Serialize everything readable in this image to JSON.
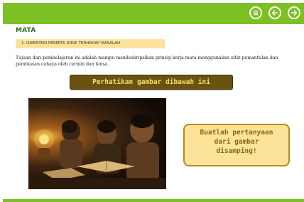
{
  "header": {
    "accent_color": "#7dc023",
    "nav": [
      {
        "name": "menu-icon"
      },
      {
        "name": "back-arrow-icon"
      },
      {
        "name": "forward-arrow-icon"
      }
    ]
  },
  "subject": "MATA",
  "section_label": "1. ORIENTASI PESERTA DIDIK TERHADAP MASALAH",
  "objective_text": "Tujuan dari pembelajaran ini adalah mampu mendeskripsikan prinsip kerja mata menggunakan sifat pemantulan dan pembiasan cahaya oleh cermin dan lensa.",
  "notice_banner": "Perhatikan gambar dibawah ini",
  "image": {
    "icon": "photo-of-children-reading-by-lamplight"
  },
  "prompt_box": {
    "lines": [
      "Buatlah pertanyaan",
      "dari gambar",
      "disamping!"
    ]
  },
  "colors": {
    "banner_bg": "#6a5210",
    "banner_text": "#f7df6a",
    "highlight_bg": "#fde39a",
    "subject_color": "#2f6a23"
  }
}
